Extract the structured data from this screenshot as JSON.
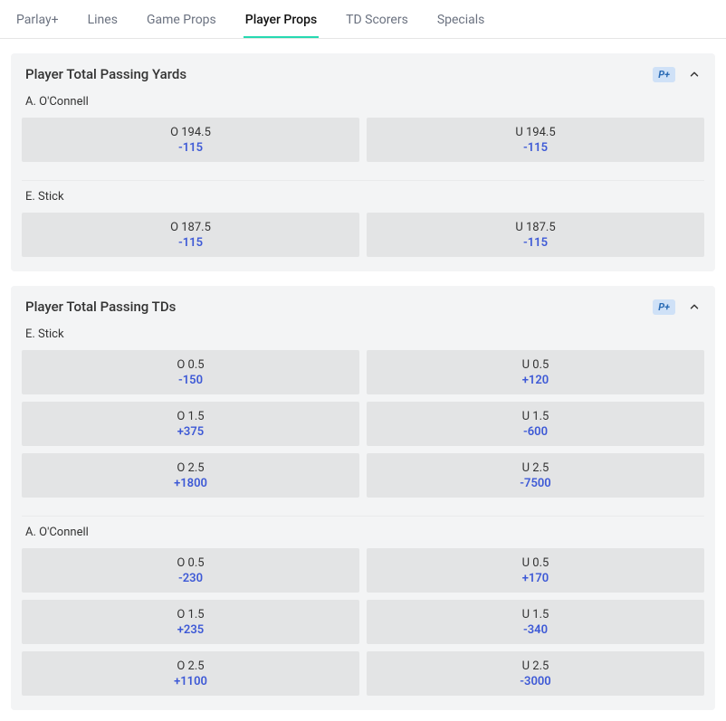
{
  "tabs": [
    {
      "label": "Parlay+",
      "active": false
    },
    {
      "label": "Lines",
      "active": false
    },
    {
      "label": "Game Props",
      "active": false
    },
    {
      "label": "Player Props",
      "active": true
    },
    {
      "label": "TD Scorers",
      "active": false
    },
    {
      "label": "Specials",
      "active": false
    }
  ],
  "badge_pplus": "P+",
  "sections": [
    {
      "title": "Player Total Passing Yards",
      "players": [
        {
          "name": "A. O'Connell",
          "rows": [
            {
              "over_line": "O 194.5",
              "over_odds": "-115",
              "under_line": "U 194.5",
              "under_odds": "-115"
            }
          ]
        },
        {
          "name": "E. Stick",
          "rows": [
            {
              "over_line": "O 187.5",
              "over_odds": "-115",
              "under_line": "U 187.5",
              "under_odds": "-115"
            }
          ]
        }
      ]
    },
    {
      "title": "Player Total Passing TDs",
      "players": [
        {
          "name": "E. Stick",
          "rows": [
            {
              "over_line": "O 0.5",
              "over_odds": "-150",
              "under_line": "U 0.5",
              "under_odds": "+120"
            },
            {
              "over_line": "O 1.5",
              "over_odds": "+375",
              "under_line": "U 1.5",
              "under_odds": "-600"
            },
            {
              "over_line": "O 2.5",
              "over_odds": "+1800",
              "under_line": "U 2.5",
              "under_odds": "-7500"
            }
          ]
        },
        {
          "name": "A. O'Connell",
          "rows": [
            {
              "over_line": "O 0.5",
              "over_odds": "-230",
              "under_line": "U 0.5",
              "under_odds": "+170"
            },
            {
              "over_line": "O 1.5",
              "over_odds": "+235",
              "under_line": "U 1.5",
              "under_odds": "-340"
            },
            {
              "over_line": "O 2.5",
              "over_odds": "+1100",
              "under_line": "U 2.5",
              "under_odds": "-3000"
            }
          ]
        }
      ]
    }
  ]
}
